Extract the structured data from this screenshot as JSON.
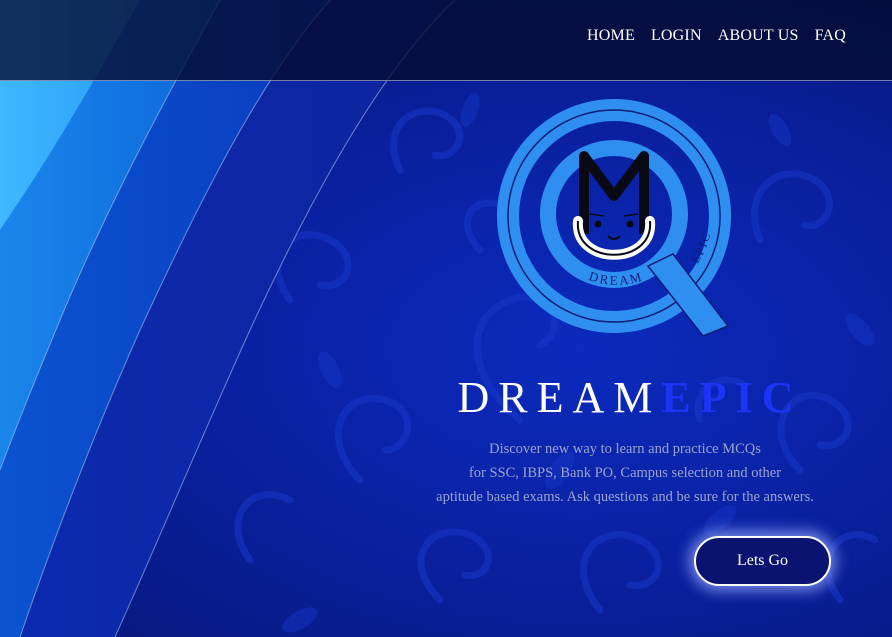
{
  "nav": {
    "items": [
      {
        "label": "HOME"
      },
      {
        "label": "LOGIN"
      },
      {
        "label": "ABOUT US"
      },
      {
        "label": "FAQ"
      }
    ]
  },
  "logo": {
    "letter": "M",
    "ring_text_bottom": "DREAM",
    "ring_text_side": "EPIC"
  },
  "hero": {
    "brand_part1": "DREAM",
    "brand_part2": "EPIC",
    "tagline_lines": [
      "Discover new way to learn and practice MCQs",
      "for SSC, IBPS, Bank PO, Campus selection and other",
      "aptitude based exams. Ask questions and be sure for the answers."
    ],
    "cta_label": "Lets Go"
  },
  "colors": {
    "background": "#0a21a3",
    "accent_blue": "#1c34f5",
    "logo_blue": "#2f8ff0",
    "navbar": "#050a2d"
  }
}
